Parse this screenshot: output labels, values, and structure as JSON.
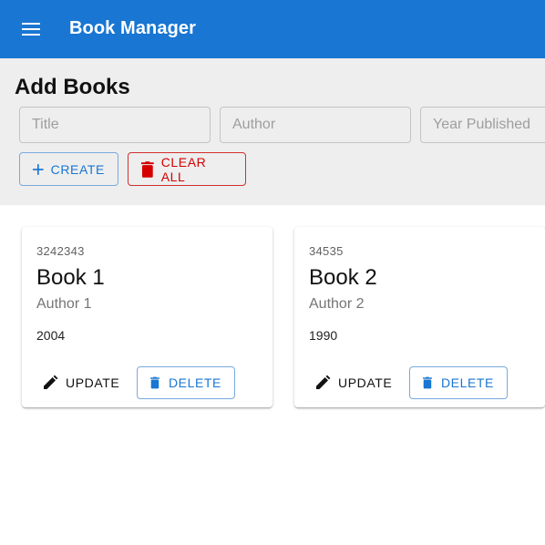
{
  "appbar": {
    "title": "Book Manager",
    "menu_icon": "menu-icon",
    "color": "#1976d2"
  },
  "add_section": {
    "title": "Add Books",
    "fields": {
      "title": {
        "placeholder": "Title",
        "value": ""
      },
      "author": {
        "placeholder": "Author",
        "value": ""
      },
      "year": {
        "placeholder": "Year Published",
        "value": ""
      }
    },
    "create_label": "CREATE",
    "clear_label": "CLEAR ALL"
  },
  "books": [
    {
      "id": "3242343",
      "title": "Book 1",
      "author": "Author 1",
      "year": "2004",
      "update_label": "UPDATE",
      "delete_label": "DELETE"
    },
    {
      "id": "34535",
      "title": "Book 2",
      "author": "Author 2",
      "year": "1990",
      "update_label": "UPDATE",
      "delete_label": "DELETE"
    }
  ],
  "colors": {
    "primary": "#1976d2",
    "danger": "#d50000",
    "section_bg": "#eeeeee"
  }
}
